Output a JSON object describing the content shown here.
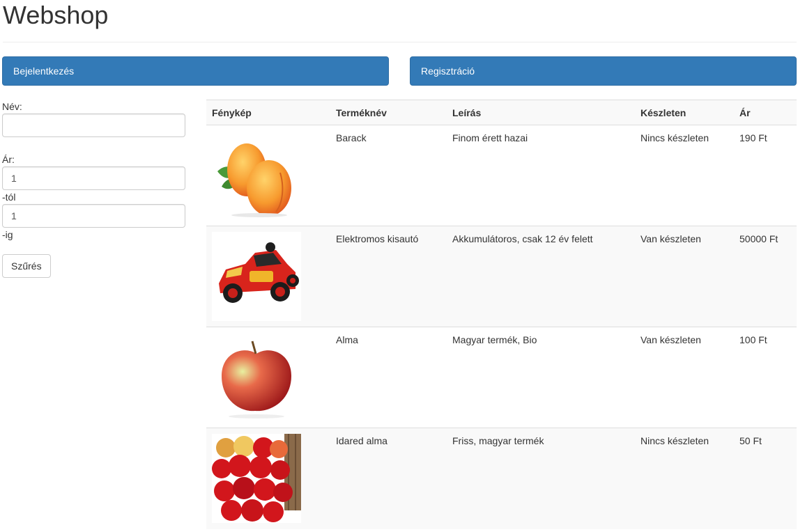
{
  "header": {
    "title": "Webshop"
  },
  "panels": {
    "login": "Bejelentkezés",
    "register": "Regisztráció"
  },
  "filter": {
    "name_label": "Név:",
    "name_value": "",
    "price_label": "Ár:",
    "price_from_value": "1",
    "from_suffix": "-tól",
    "price_to_value": "1",
    "to_suffix": "-ig",
    "button_label": "Szűrés"
  },
  "table": {
    "columns": [
      "Fénykép",
      "Terméknév",
      "Leírás",
      "Készleten",
      "Ár"
    ],
    "rows": [
      {
        "image": "peach-image",
        "name": "Barack",
        "description": "Finom érett hazai",
        "stock": "Nincs készleten",
        "price": "190 Ft"
      },
      {
        "image": "toy-car-image",
        "name": "Elektromos kisautó",
        "description": "Akkumulátoros, csak 12 év felett",
        "stock": "Van készleten",
        "price": "50000 Ft"
      },
      {
        "image": "apple-image",
        "name": "Alma",
        "description": "Magyar termék, Bio",
        "stock": "Van készleten",
        "price": "100 Ft"
      },
      {
        "image": "idared-apples-image",
        "name": "Idared alma",
        "description": "Friss, magyar termék",
        "stock": "Nincs készleten",
        "price": "50 Ft"
      }
    ]
  },
  "colors": {
    "primary": "#337ab7",
    "border": "#dddddd",
    "stripe": "#f9f9f9"
  }
}
